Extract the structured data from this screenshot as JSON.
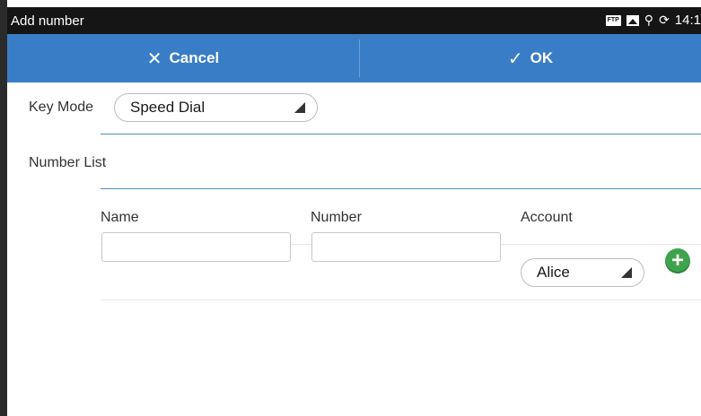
{
  "status_bar": {
    "title": "Add number",
    "icons": [
      "ftp-icon",
      "image-icon",
      "usb-icon",
      "sync-icon"
    ],
    "ftp_label": "FTP",
    "time": "14:1"
  },
  "action_bar": {
    "cancel_label": "Cancel",
    "cancel_icon": "✕",
    "ok_label": "OK",
    "ok_icon": "✓",
    "color": "#3a7dc7"
  },
  "key_mode": {
    "label": "Key Mode",
    "value": "Speed Dial"
  },
  "number_list": {
    "label": "Number List",
    "columns": [
      "Name",
      "Number",
      "Account"
    ],
    "row": {
      "name": "",
      "number": "",
      "account": "Alice"
    },
    "add_icon": "+",
    "add_color": "#3fa34d"
  }
}
